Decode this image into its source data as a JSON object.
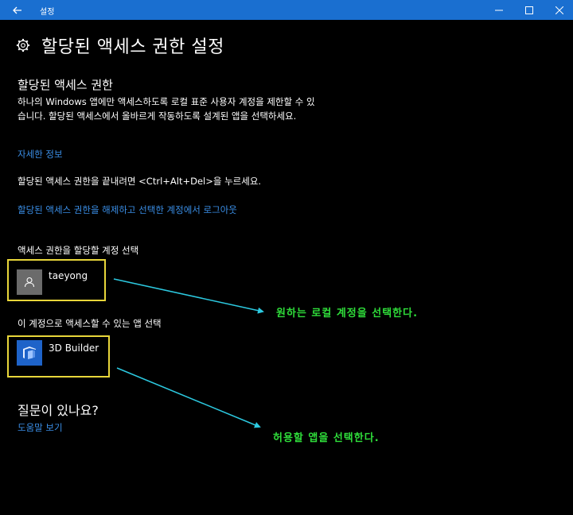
{
  "window": {
    "title": "설정"
  },
  "page": {
    "title": "할당된 액세스 권한 설정"
  },
  "assigned_access": {
    "title": "할당된 액세스 권한",
    "description": "하나의 Windows 앱에만 액세스하도록 로컬 표준 사용자 계정을 제한할 수 있습니다. 할당된 액세스에서 올바르게 작동하도록 설계된 앱을 선택하세요.",
    "more_info_link": "자세한 정보",
    "exit_hint": "할당된 액세스 권한을 끝내려면 <Ctrl+Alt+Del>을 누르세요.",
    "sign_out_link": "할당된 액세스 권한을 해제하고 선택한 계정에서 로그아웃"
  },
  "account": {
    "label": "액세스 권한을 할당할 계정 선택",
    "name": "taeyong"
  },
  "app": {
    "label": "이 계정으로 액세스할 수 있는 앱 선택",
    "name": "3D Builder"
  },
  "help": {
    "question": "질문이 있나요?",
    "link": "도움말 보기"
  },
  "annotations": {
    "account": "원하는 로컬 계정을 선택한다.",
    "app": "허용할 앱을 선택한다."
  },
  "colors": {
    "titlebar": "#1a6fd0",
    "link": "#3a8ee6",
    "highlight_box": "#e8d63a",
    "annotation_text": "#2fdd3a",
    "arrow": "#2cc9e0"
  }
}
